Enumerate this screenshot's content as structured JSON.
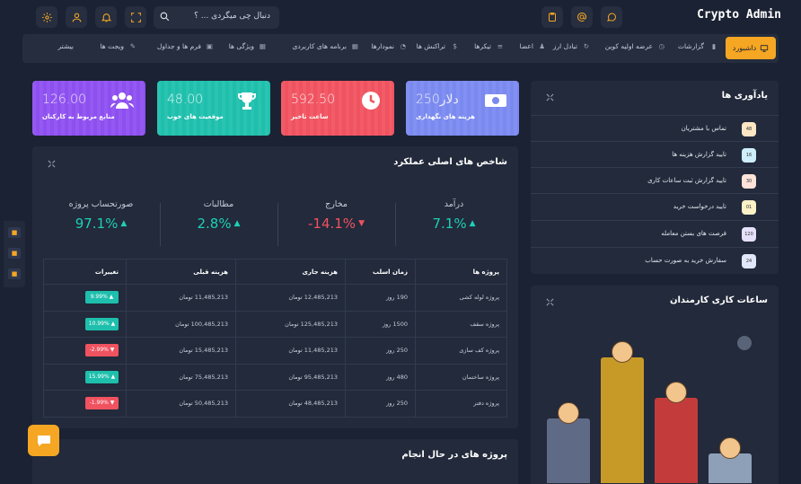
{
  "app": {
    "brand": "Crypto Admin"
  },
  "search": {
    "placeholder": "دنبال چی میگردی ... ؟"
  },
  "nav": {
    "active": "داشبورد",
    "items": [
      "گزارشات",
      "عرضه اولیه کوین",
      "تبادل ارز",
      "اعضا",
      "تیکرها",
      "تراکنش ها",
      "نمودارها",
      "برنامه های کاربردی",
      "ویژگی ها",
      "فرم ها و جداول",
      "ویجت ها",
      "بیشتر"
    ]
  },
  "stats": [
    {
      "value": "250دلار",
      "label": "هزینه های نگهداری",
      "color": "#7a89f0",
      "icon": "money-icon"
    },
    {
      "value": "592.50",
      "label": "ساعت تاخیر",
      "color": "#f0525f",
      "icon": "clock-icon"
    },
    {
      "value": "48.00",
      "label": "موقعیت های خوب",
      "color": "#1ebfac",
      "icon": "trophy-icon"
    },
    {
      "value": "126.00",
      "label": "منابع مربوط به کارکنان",
      "color": "#8d4ff0",
      "icon": "users-icon"
    }
  ],
  "kpi": {
    "title": "شاخص های اصلی عملکرد",
    "items": [
      {
        "label": "درآمد",
        "value": "7.1%",
        "dir": "up",
        "color": "#1ecfb6"
      },
      {
        "label": "مخارج",
        "value": "-14.1%",
        "dir": "down",
        "color": "#f0525f"
      },
      {
        "label": "مطالبات",
        "value": "2.8%",
        "dir": "up",
        "color": "#1ecfb6"
      },
      {
        "label": "صورتحساب پروژه",
        "value": "97.1%",
        "dir": "up",
        "color": "#1ecfb6"
      }
    ]
  },
  "table": {
    "headers": [
      "پروژه ها",
      "زمان اسلب",
      "هزینه جاری",
      "هزینه قبلی",
      "تغییرات"
    ],
    "rows": [
      [
        "پروژه لوله کشی",
        "190 روز",
        "12,485,213 تومان",
        "11,485,213 تومان",
        "9.99%",
        "up"
      ],
      [
        "پروژه سقف",
        "1500 روز",
        "125,485,213 تومان",
        "100,485,213 تومان",
        "10.99%",
        "up"
      ],
      [
        "پروژه کف سازی",
        "250 روز",
        "11,485,213 تومان",
        "15,485,213 تومان",
        "-2.99%",
        "down"
      ],
      [
        "پروژه ساختمان",
        "480 روز",
        "95,485,213 تومان",
        "75,485,213 تومان",
        "15.99%",
        "up"
      ],
      [
        "پروژه دفتر",
        "250 روز",
        "48,485,213 تومان",
        "50,485,213 تومان",
        "-1.99%",
        "down"
      ]
    ]
  },
  "reminders": {
    "title": "یادآوری ها",
    "items": [
      {
        "text": "تماس با مشتریان",
        "badge": "48",
        "bg": "#fde6c3"
      },
      {
        "text": "تایید گزارش هزینه ها",
        "badge": "16",
        "bg": "#cdeefa"
      },
      {
        "text": "تایید گزارش ثبت ساعات کاری",
        "badge": "30",
        "bg": "#fde3d8"
      },
      {
        "text": "تایید درخواست خرید",
        "badge": "01",
        "bg": "#fdf1c8"
      },
      {
        "text": "فرصت های بستن معامله",
        "badge": "120",
        "bg": "#e6e0fb"
      },
      {
        "text": "سفارش خرید به صورت حساب",
        "badge": "24",
        "bg": "#e1e6fb"
      }
    ]
  },
  "hours": {
    "title": "ساعات کاری کارمندان",
    "bars": [
      {
        "level": 0.48,
        "color": "#5f6b86"
      },
      {
        "level": 0.93,
        "color": "#c79a28"
      },
      {
        "level": 0.63,
        "color": "#c33b3b"
      },
      {
        "level": 0.22,
        "color": "#8ea0b8"
      }
    ]
  },
  "projects": {
    "title": "پروژه های در حال انجام"
  }
}
